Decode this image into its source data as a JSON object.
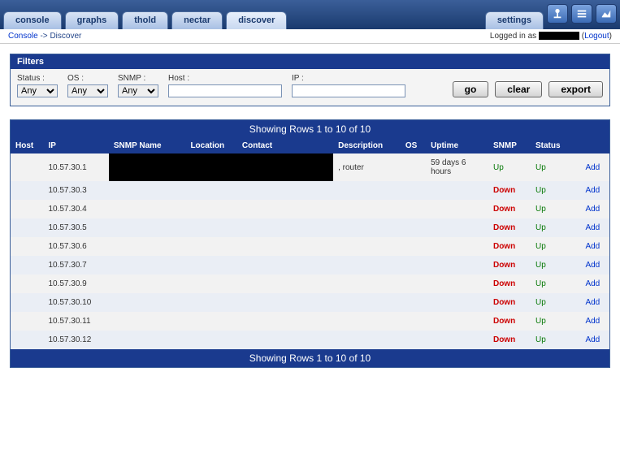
{
  "nav": {
    "tabs": [
      "console",
      "graphs",
      "thold",
      "nectar",
      "discover"
    ],
    "settings": "settings"
  },
  "breadcrumb": {
    "console": "Console",
    "sep": " -> ",
    "current": "Discover",
    "login_prefix": "Logged in as ",
    "logout": "Logout"
  },
  "filters": {
    "title": "Filters",
    "status_label": "Status :",
    "os_label": "OS :",
    "snmp_label": "SNMP :",
    "host_label": "Host :",
    "ip_label": "IP :",
    "option_any": "Any",
    "go": "go",
    "clear": "clear",
    "export": "export"
  },
  "banner": "Showing Rows 1 to 10 of 10",
  "columns": {
    "host": "Host",
    "ip": "IP",
    "snmp_name": "SNMP Name",
    "location": "Location",
    "contact": "Contact",
    "description": "Description",
    "os": "OS",
    "uptime": "Uptime",
    "snmp": "SNMP",
    "status": "Status",
    "action": ""
  },
  "action_label": "Add",
  "rows": [
    {
      "ip": "10.57.30.1",
      "snmp_name": "__REDACTED__",
      "location": "__REDACTED__",
      "contact": "__REDACTED__",
      "description": ", router",
      "os": "",
      "uptime": "59 days 6 hours",
      "snmp": "Up",
      "status": "Up"
    },
    {
      "ip": "10.57.30.3",
      "snmp_name": "",
      "location": "",
      "contact": "",
      "description": "",
      "os": "",
      "uptime": "",
      "snmp": "Down",
      "status": "Up"
    },
    {
      "ip": "10.57.30.4",
      "snmp_name": "",
      "location": "",
      "contact": "",
      "description": "",
      "os": "",
      "uptime": "",
      "snmp": "Down",
      "status": "Up"
    },
    {
      "ip": "10.57.30.5",
      "snmp_name": "",
      "location": "",
      "contact": "",
      "description": "",
      "os": "",
      "uptime": "",
      "snmp": "Down",
      "status": "Up"
    },
    {
      "ip": "10.57.30.6",
      "snmp_name": "",
      "location": "",
      "contact": "",
      "description": "",
      "os": "",
      "uptime": "",
      "snmp": "Down",
      "status": "Up"
    },
    {
      "ip": "10.57.30.7",
      "snmp_name": "",
      "location": "",
      "contact": "",
      "description": "",
      "os": "",
      "uptime": "",
      "snmp": "Down",
      "status": "Up"
    },
    {
      "ip": "10.57.30.9",
      "snmp_name": "",
      "location": "",
      "contact": "",
      "description": "",
      "os": "",
      "uptime": "",
      "snmp": "Down",
      "status": "Up"
    },
    {
      "ip": "10.57.30.10",
      "snmp_name": "",
      "location": "",
      "contact": "",
      "description": "",
      "os": "",
      "uptime": "",
      "snmp": "Down",
      "status": "Up"
    },
    {
      "ip": "10.57.30.11",
      "snmp_name": "",
      "location": "",
      "contact": "",
      "description": "",
      "os": "",
      "uptime": "",
      "snmp": "Down",
      "status": "Up"
    },
    {
      "ip": "10.57.30.12",
      "snmp_name": "",
      "location": "",
      "contact": "",
      "description": "",
      "os": "",
      "uptime": "",
      "snmp": "Down",
      "status": "Up"
    }
  ]
}
